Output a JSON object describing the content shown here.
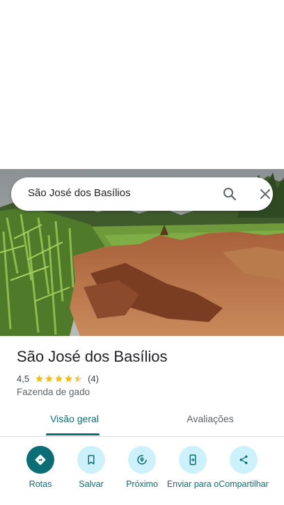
{
  "search": {
    "query": "São José dos Basílios",
    "search_icon": "search-icon",
    "close_icon": "close-icon"
  },
  "place": {
    "name": "São José dos Basílios",
    "rating": "4,5",
    "rating_stars": 4.5,
    "review_count": "(4)",
    "category": "Fazenda de gado"
  },
  "tabs": [
    {
      "label": "Visão geral",
      "active": true
    },
    {
      "label": "Avaliações",
      "active": false
    }
  ],
  "actions": [
    {
      "label": "Rotas",
      "icon": "directions-icon"
    },
    {
      "label": "Salvar",
      "icon": "bookmark-icon"
    },
    {
      "label": "Próximo",
      "icon": "nearby-icon"
    },
    {
      "label": "Enviar para o",
      "icon": "send-to-phone-icon"
    },
    {
      "label": "Compartilhar",
      "icon": "share-icon"
    }
  ],
  "colors": {
    "accent": "#0b6e74",
    "action_bg": "#cdf1fb",
    "star": "#fbbc04"
  }
}
